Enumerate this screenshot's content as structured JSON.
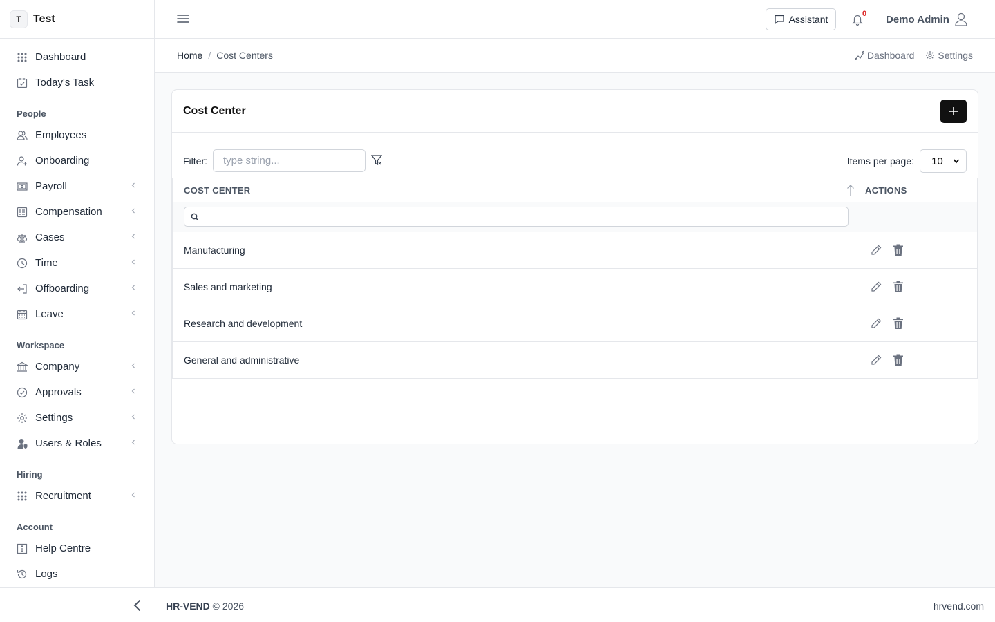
{
  "brand": {
    "initial": "T",
    "name": "Test"
  },
  "sidebar": {
    "top_items": [
      {
        "label": "Dashboard",
        "icon": "grid-icon"
      },
      {
        "label": "Today's Task",
        "icon": "calendar-check-icon"
      }
    ],
    "sections": [
      {
        "title": "People",
        "items": [
          {
            "label": "Employees",
            "icon": "users-icon",
            "has_submenu": false
          },
          {
            "label": "Onboarding",
            "icon": "user-plus-icon",
            "has_submenu": false
          },
          {
            "label": "Payroll",
            "icon": "banknote-icon",
            "has_submenu": true
          },
          {
            "label": "Compensation",
            "icon": "list-icon",
            "has_submenu": true
          },
          {
            "label": "Cases",
            "icon": "scale-icon",
            "has_submenu": true
          },
          {
            "label": "Time",
            "icon": "clock-icon",
            "has_submenu": true
          },
          {
            "label": "Offboarding",
            "icon": "exit-icon",
            "has_submenu": true
          },
          {
            "label": "Leave",
            "icon": "calendar-icon",
            "has_submenu": true
          }
        ]
      },
      {
        "title": "Workspace",
        "items": [
          {
            "label": "Company",
            "icon": "bank-icon",
            "has_submenu": true
          },
          {
            "label": "Approvals",
            "icon": "check-circle-icon",
            "has_submenu": true
          },
          {
            "label": "Settings",
            "icon": "gear-icon",
            "has_submenu": true
          },
          {
            "label": "Users & Roles",
            "icon": "user-shield-icon",
            "has_submenu": true
          }
        ]
      },
      {
        "title": "Hiring",
        "items": [
          {
            "label": "Recruitment",
            "icon": "grid-icon",
            "has_submenu": true
          }
        ]
      },
      {
        "title": "Account",
        "items": [
          {
            "label": "Help Centre",
            "icon": "info-icon",
            "has_submenu": false
          },
          {
            "label": "Logs",
            "icon": "history-icon",
            "has_submenu": false
          }
        ]
      }
    ]
  },
  "topbar": {
    "assistant_label": "Assistant",
    "notification_count": "0",
    "user_name": "Demo Admin"
  },
  "breadcrumb": {
    "home": "Home",
    "separator": "/",
    "current": "Cost Centers"
  },
  "quick_links": {
    "dashboard": "Dashboard",
    "settings": "Settings"
  },
  "card": {
    "title": "Cost Center",
    "filter_label": "Filter:",
    "filter_placeholder": "type string...",
    "items_per_page_label": "Items per page:",
    "items_per_page_value": "10"
  },
  "table": {
    "columns": {
      "name": "COST CENTER",
      "actions": "ACTIONS"
    },
    "rows": [
      {
        "name": "Manufacturing"
      },
      {
        "name": "Sales and marketing"
      },
      {
        "name": "Research and development"
      },
      {
        "name": "General and administrative"
      }
    ]
  },
  "footer": {
    "brand": "HR-VEND",
    "copyright": "© 2026",
    "site": "hrvend.com"
  }
}
